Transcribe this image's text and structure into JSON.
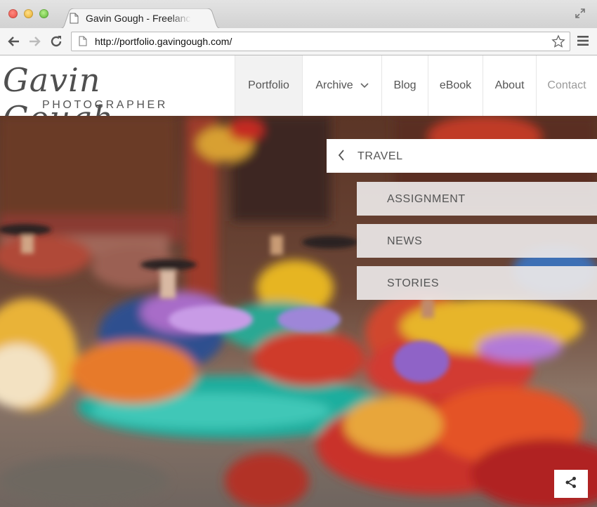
{
  "browser": {
    "tab_title": "Gavin Gough - Freelance Photographer",
    "url": "http://portfolio.gavingough.com/"
  },
  "site": {
    "logo_script": "Gavin Gough",
    "logo_subtitle": "PHOTOGRAPHER",
    "nav": [
      {
        "label": "Portfolio",
        "state": "active"
      },
      {
        "label": "Archive",
        "has_dropdown": true
      },
      {
        "label": "Blog"
      },
      {
        "label": "eBook"
      },
      {
        "label": "About"
      },
      {
        "label": "Contact",
        "state": "dimmed"
      }
    ]
  },
  "menu": {
    "parent": "TRAVEL",
    "items": [
      "ASSIGNMENT",
      "NEWS",
      "STORIES"
    ]
  },
  "icons": {
    "share": "share-icon",
    "back": "chevron-left-icon"
  }
}
